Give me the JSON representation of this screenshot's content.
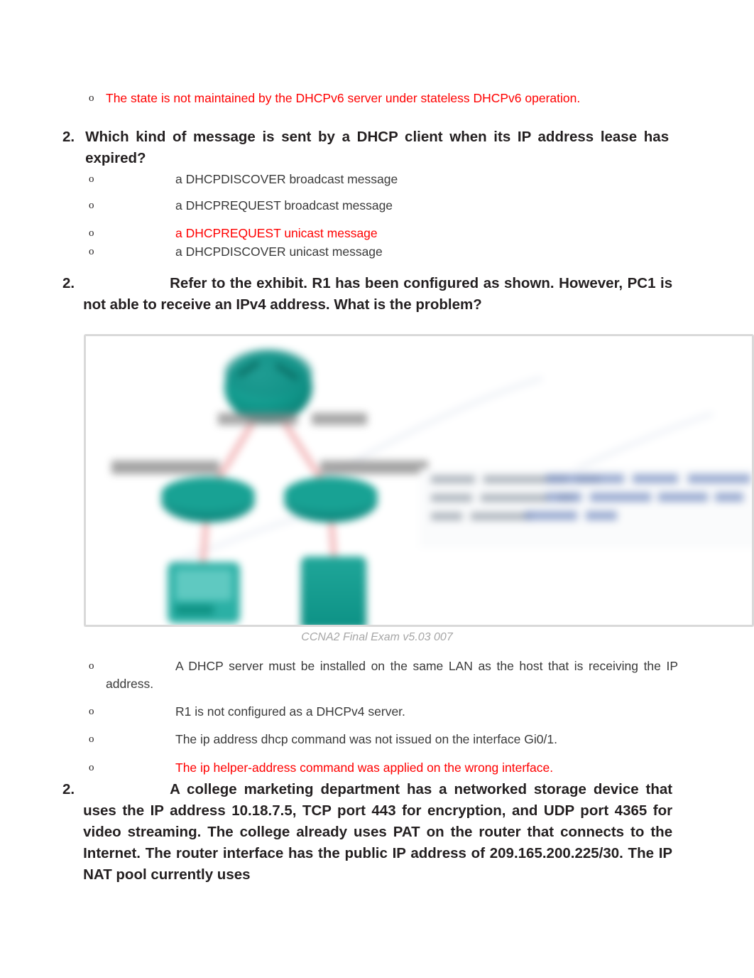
{
  "document": {
    "caption": "CCNA2 Final Exam v5.03 007",
    "colors": {
      "correct_answer": "#ff0000",
      "body_text": "#3a3a3a",
      "heading_text": "#231f20",
      "caption_text": "#a6a6a6",
      "device_teal": "#0f9b8e",
      "link_pink": "#f2b9bb",
      "exhibit_border": "#d9d9d9"
    },
    "bullet_marker": "o"
  },
  "questions": [
    {
      "id": "q1-tail",
      "number": "",
      "options": [
        {
          "marker": "o",
          "text": "The state is not maintained by the DHCPv6 server under stateless DHCPv6 operation.",
          "correct": true
        }
      ]
    },
    {
      "id": "q2",
      "number": "2.",
      "text": "Which kind of message is sent by a DHCP client when its IP address lease has expired?",
      "options": [
        {
          "marker": "o",
          "text": "a DHCPDISCOVER broadcast message",
          "correct": false
        },
        {
          "marker": "o",
          "text": "a DHCPREQUEST broadcast message",
          "correct": false
        },
        {
          "marker": "o",
          "text": "a DHCPREQUEST unicast message",
          "correct": true
        },
        {
          "marker": "o",
          "text": "a DHCPDISCOVER unicast message",
          "correct": false
        }
      ]
    },
    {
      "id": "q3",
      "number": "2.",
      "text": "Refer to the exhibit. R1 has been configured as shown. However, PC1 is not able to receive an IPv4 address. What is the problem?",
      "exhibit_caption": "CCNA2 Final Exam v5.03 007",
      "options": [
        {
          "marker": "o",
          "text": "A DHCP server must be installed on the same LAN as the host that is receiving the IP address.",
          "correct": false
        },
        {
          "marker": "o",
          "text": "R1 is not configured as a DHCPv4 server.",
          "correct": false
        },
        {
          "marker": "o",
          "text": "The ip address dhcp command was not issued on the interface Gi0/1.",
          "correct": false
        },
        {
          "marker": "o",
          "text": "The ip helper-address command was applied on the wrong interface.",
          "correct": true
        }
      ]
    },
    {
      "id": "q4",
      "number": "2.",
      "text": "A  college marketing department has  a networked storage device that uses the IP address 10.18.7.5, TCP port 443 for encryption, and UDP port 4365 for video streaming. The college already uses PAT on the router that connects to the Internet. The router interface has the public IP address of 209.165.200.225/30. The IP NAT pool currently uses"
    }
  ]
}
